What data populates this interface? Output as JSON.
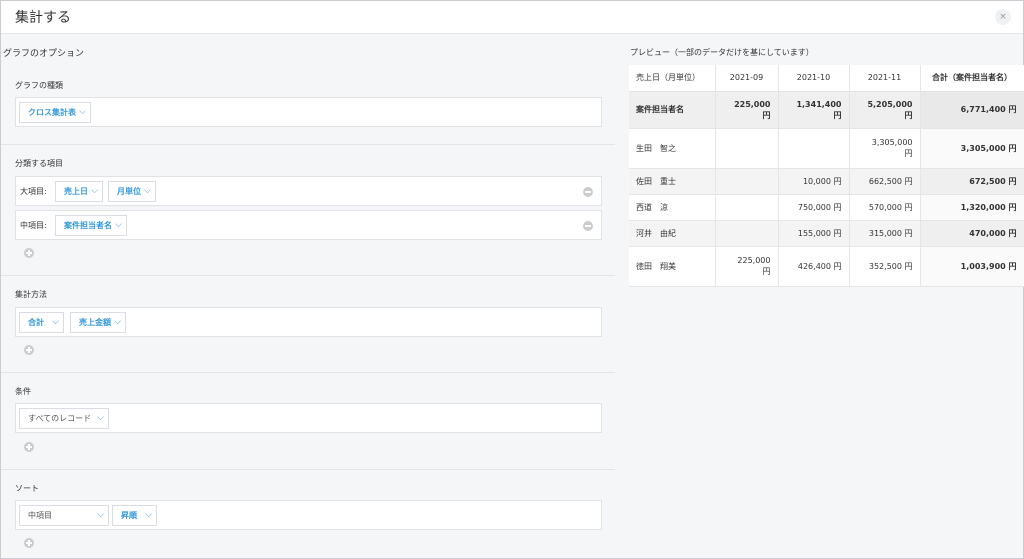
{
  "dialog": {
    "title": "集計する",
    "close": "×"
  },
  "options": {
    "heading": "グラフのオプション",
    "chart_type": {
      "label": "グラフの種類",
      "value": "クロス集計表"
    },
    "group": {
      "label": "分類する項目",
      "major": {
        "prefix": "大項目:",
        "field": "売上日",
        "unit": "月単位"
      },
      "minor": {
        "prefix": "中項目:",
        "field": "案件担当者名"
      }
    },
    "method": {
      "label": "集計方法",
      "func": "合計",
      "field": "売上金額"
    },
    "condition": {
      "label": "条件",
      "value": "すべてのレコード"
    },
    "sort": {
      "label": "ソート",
      "key": "中項目",
      "order": "昇順"
    }
  },
  "preview": {
    "title": "プレビュー（一部のデータだけを基にしています）",
    "headers": [
      "売上日（月単位）",
      "2021-09",
      "2021-10",
      "2021-11",
      "合計（案件担当者名）"
    ],
    "sum_row": {
      "label": "案件担当者名",
      "values": [
        "225,000",
        "1,341,400",
        "5,205,000"
      ],
      "unit": "円",
      "total": "6,771,400 円"
    },
    "rows": [
      {
        "name": "生田　智之",
        "values": [
          "",
          "",
          "3,305,000"
        ],
        "total": "3,305,000 円"
      },
      {
        "name": "佐田　重士",
        "values": [
          "",
          "10,000 円",
          "662,500 円"
        ],
        "total": "672,500 円"
      },
      {
        "name": "西道　涼",
        "values": [
          "",
          "750,000 円",
          "570,000 円"
        ],
        "total": "1,320,000 円"
      },
      {
        "name": "河井　由紀",
        "values": [
          "",
          "155,000 円",
          "315,000 円"
        ],
        "total": "470,000 円"
      },
      {
        "name": "徳田　翔美",
        "values": [
          "225,000",
          "426,400 円",
          "352,500 円"
        ],
        "total": "1,003,900 円"
      }
    ],
    "unit": "円"
  }
}
